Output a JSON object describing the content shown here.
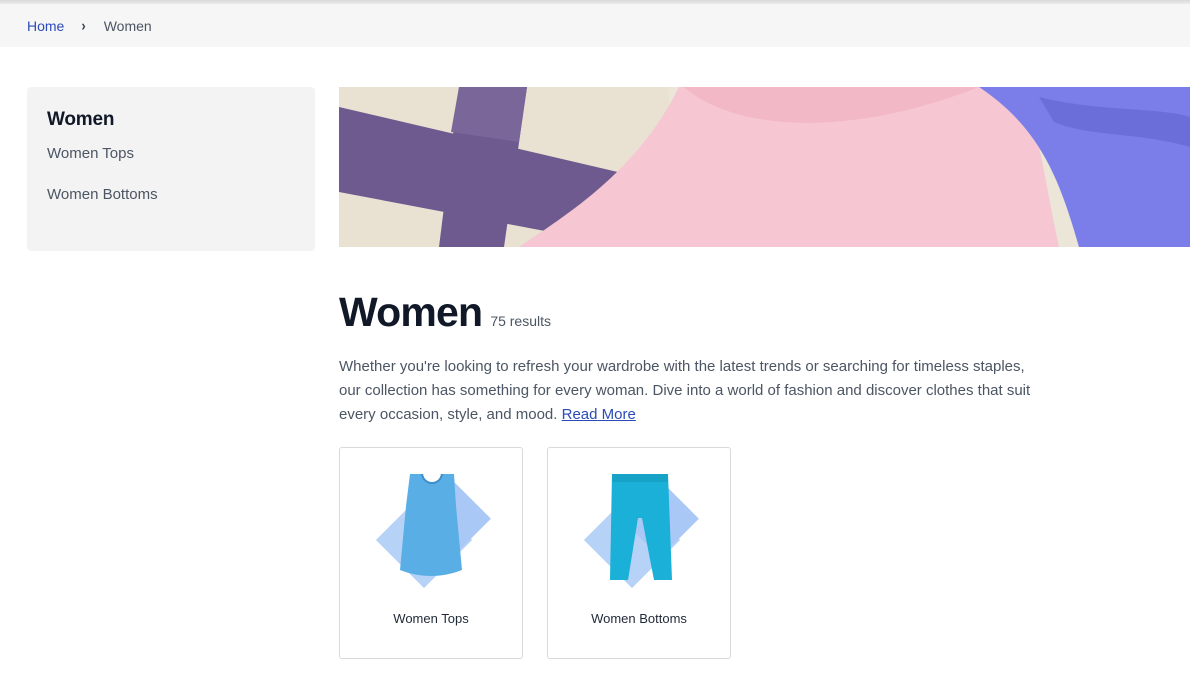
{
  "breadcrumb": {
    "home": "Home",
    "separator": "›",
    "current": "Women"
  },
  "sidebar": {
    "title": "Women",
    "items": [
      {
        "label": "Women Tops"
      },
      {
        "label": "Women Bottoms"
      }
    ]
  },
  "category": {
    "title": "Women",
    "results": "75 results",
    "description": "Whether you're looking to refresh your wardrobe with the latest trends or searching for timeless staples, our collection has something for every woman. Dive into a world of fashion and discover clothes that suit every occasion, style, and mood.",
    "read_more": "Read More"
  },
  "subcategories": [
    {
      "label": "Women Tops",
      "icon": "tank-top-icon"
    },
    {
      "label": "Women Bottoms",
      "icon": "shorts-icon"
    }
  ],
  "colors": {
    "link": "#2a4bb8",
    "banner_pink": "#f6c6d2",
    "banner_purple": "#6f5a8f",
    "banner_blue": "#7b7ee8",
    "product_top": "#5aaee6",
    "product_bottom": "#1ab0d8"
  }
}
